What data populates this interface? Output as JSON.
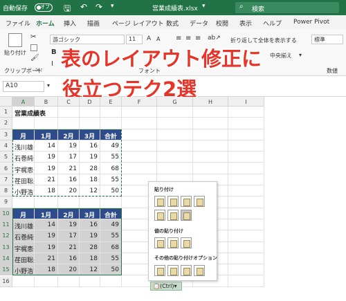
{
  "titlebar": {
    "autosave": "自動保存",
    "autosave_state": "オフ",
    "filename": "営業成績表.xlsx",
    "search": "検索"
  },
  "tabs": [
    "ファイル",
    "ホーム",
    "挿入",
    "描画",
    "ページ レイアウト",
    "数式",
    "データ",
    "校閲",
    "表示",
    "ヘルプ",
    "Power Pivot"
  ],
  "ribbon": {
    "paste": "貼り付け",
    "clipboard_group": "クリップボード",
    "font_name": "游ゴシック",
    "font_size": "11",
    "font_group": "フォント",
    "wrap": "折り返して全体を表示する",
    "center": "中央揃え",
    "number_format": "標準",
    "number_group": "数値"
  },
  "namebox": "A10",
  "overlay": {
    "line1": "表のレイアウト修正に",
    "line2": "役立つテク2選"
  },
  "columns": [
    "A",
    "B",
    "C",
    "D",
    "E",
    "F",
    "G",
    "H",
    "I"
  ],
  "rows": [
    "1",
    "2",
    "3",
    "4",
    "5",
    "6",
    "7",
    "8",
    "9",
    "10",
    "11",
    "12",
    "13",
    "14",
    "15",
    "16"
  ],
  "sheet": {
    "title": "営業成績表",
    "headers": [
      "月",
      "1月",
      "2月",
      "3月",
      "合計"
    ],
    "table1": [
      [
        "浅川雄平",
        "14",
        "19",
        "16",
        "49"
      ],
      [
        "石巻純也",
        "19",
        "17",
        "19",
        "55"
      ],
      [
        "宇梶恵子",
        "19",
        "21",
        "28",
        "68"
      ],
      [
        "荏田聡美",
        "21",
        "16",
        "18",
        "55"
      ],
      [
        "小野浩司",
        "18",
        "20",
        "12",
        "50"
      ]
    ],
    "table2": [
      [
        "浅川雄平",
        "14",
        "19",
        "16",
        "49"
      ],
      [
        "石巻純也",
        "19",
        "17",
        "19",
        "55"
      ],
      [
        "宇梶恵子",
        "19",
        "21",
        "28",
        "68"
      ],
      [
        "荏田聡美",
        "21",
        "16",
        "18",
        "55"
      ],
      [
        "小野浩司",
        "18",
        "20",
        "12",
        "50"
      ]
    ]
  },
  "paste_menu": {
    "section1": "貼り付け",
    "section2": "値の貼り付け",
    "section3": "その他の貼り付けオプション",
    "ctrl": "(Ctrl)"
  },
  "colors": {
    "excel_green": "#217346",
    "table_header": "#2e4c8c",
    "overlay_red": "#e83328"
  }
}
